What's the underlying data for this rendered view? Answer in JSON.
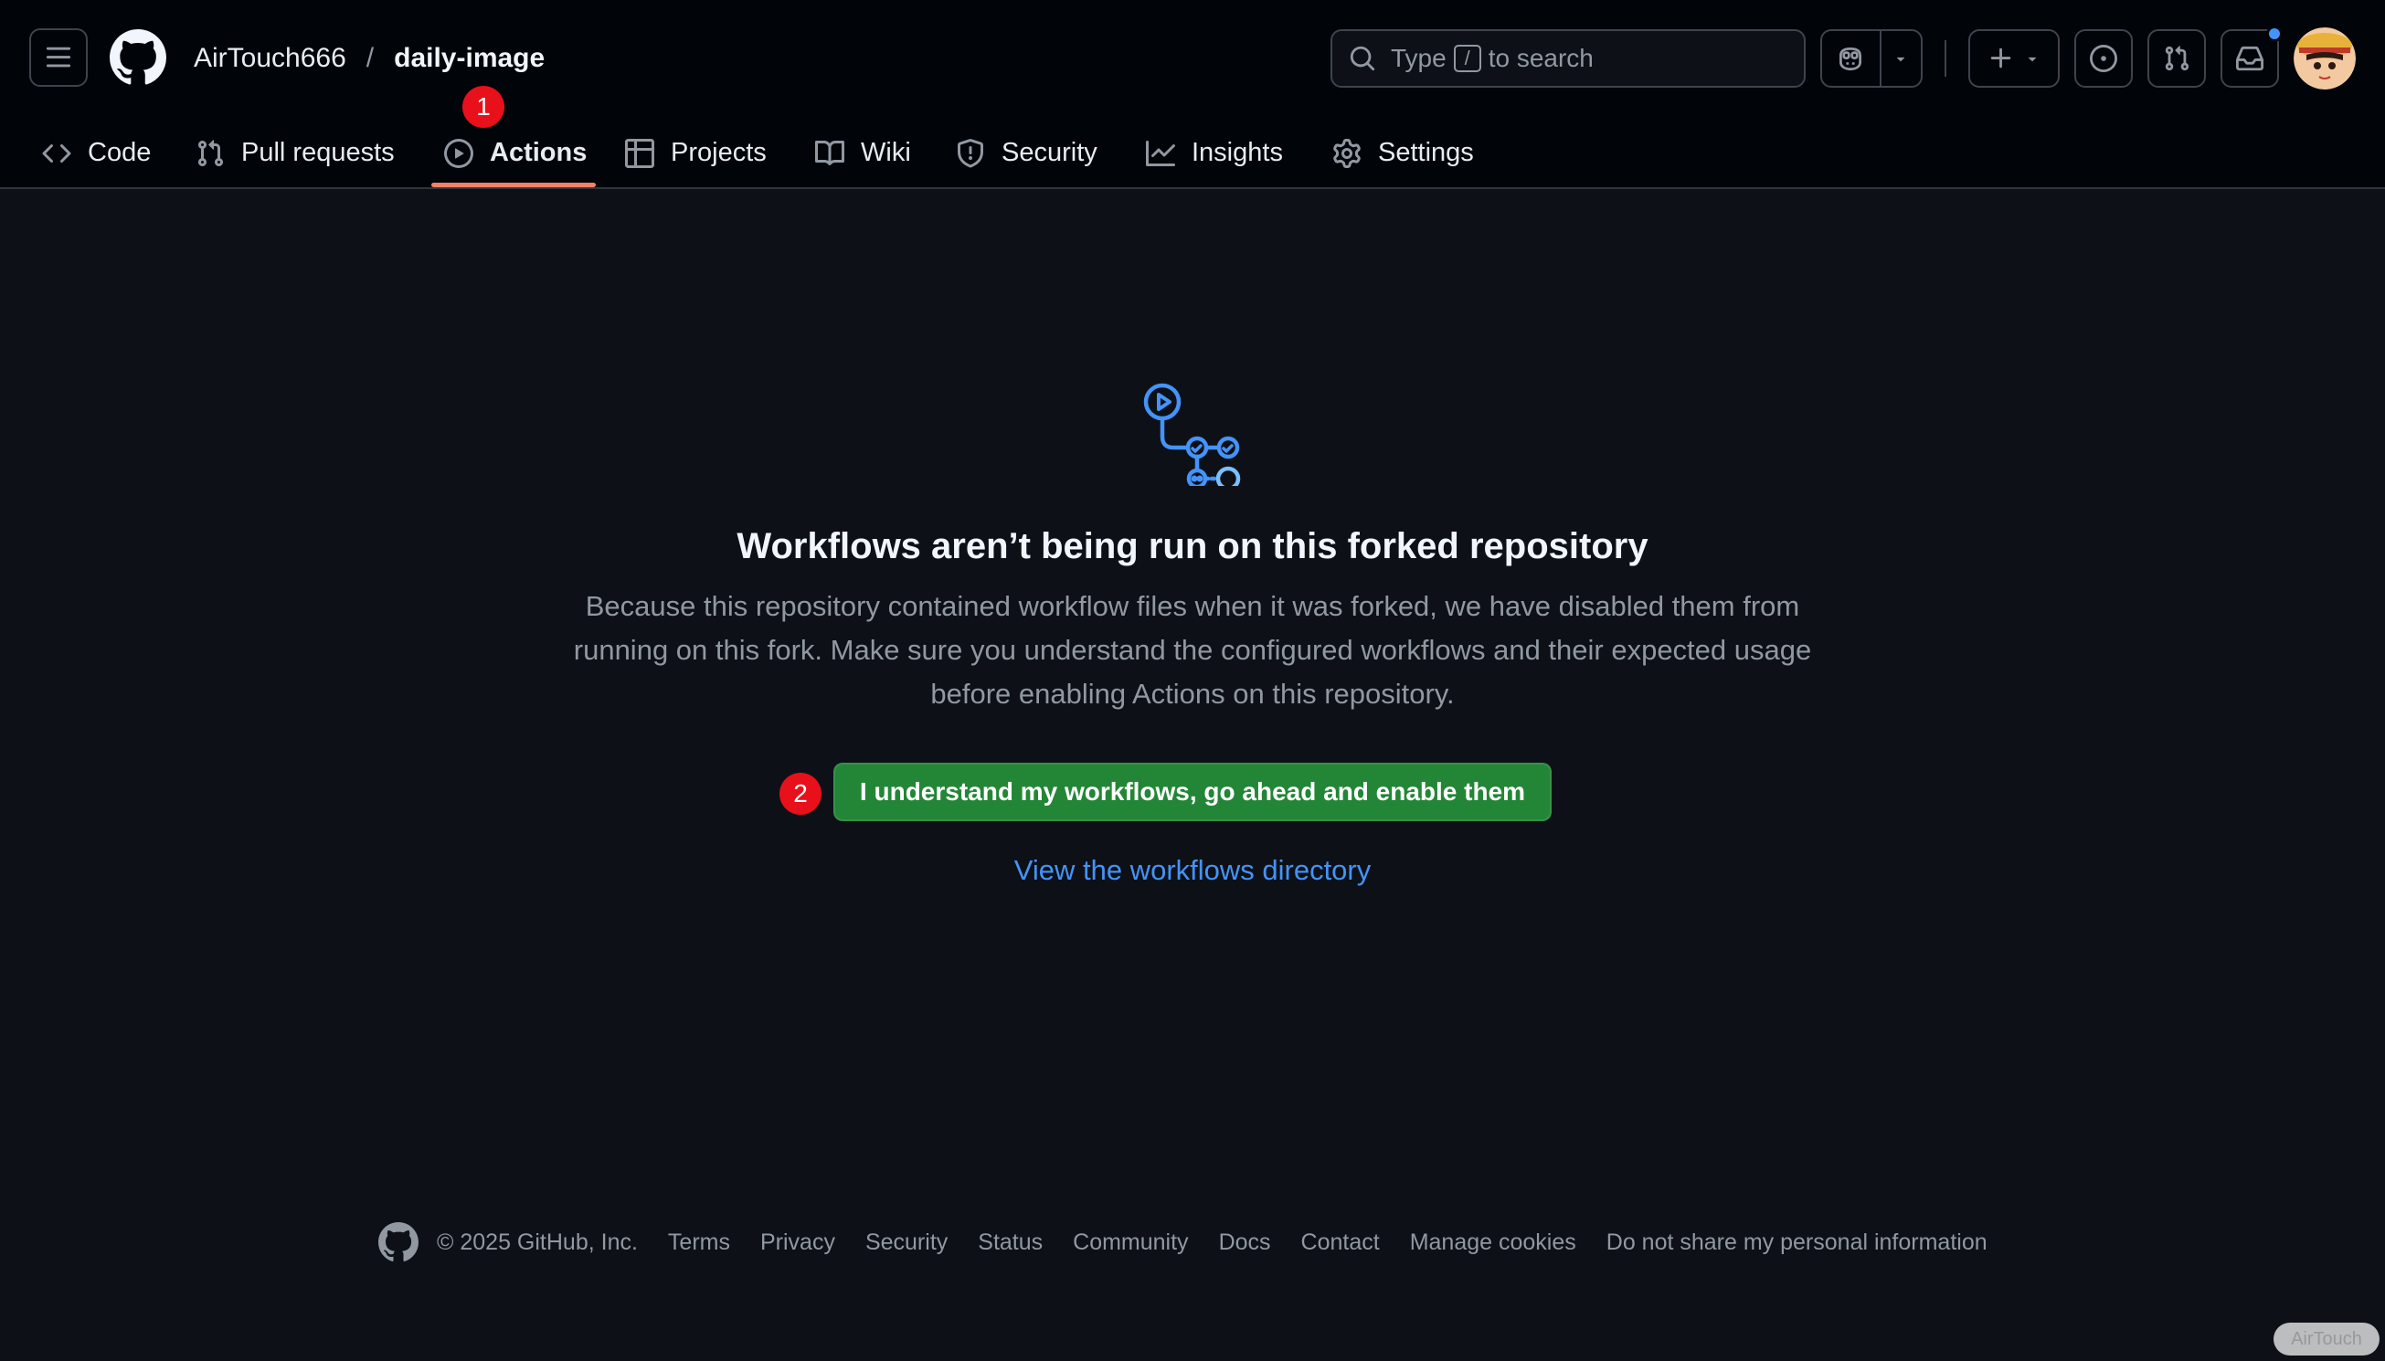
{
  "header": {
    "owner": "AirTouch666",
    "separator": "/",
    "repo": "daily-image",
    "search": {
      "before": "Type",
      "key": "/",
      "after": "to search"
    }
  },
  "tabs": [
    {
      "label": "Code",
      "icon": "code-icon"
    },
    {
      "label": "Pull requests",
      "icon": "git-pull-request-icon"
    },
    {
      "label": "Actions",
      "icon": "play-icon",
      "active": true
    },
    {
      "label": "Projects",
      "icon": "table-icon"
    },
    {
      "label": "Wiki",
      "icon": "book-icon"
    },
    {
      "label": "Security",
      "icon": "shield-icon"
    },
    {
      "label": "Insights",
      "icon": "graph-icon"
    },
    {
      "label": "Settings",
      "icon": "gear-icon"
    }
  ],
  "markers": {
    "one": "1",
    "two": "2"
  },
  "main": {
    "title": "Workflows aren’t being run on this forked repository",
    "description": "Because this repository contained workflow files when it was forked, we have disabled them from running on this fork. Make sure you understand the configured workflows and their expected usage before enabling Actions on this repository.",
    "enable_button": "I understand my workflows, go ahead and enable them",
    "view_link": "View the workflows directory"
  },
  "footer": {
    "copyright": "© 2025 GitHub, Inc.",
    "links": [
      "Terms",
      "Privacy",
      "Security",
      "Status",
      "Community",
      "Docs",
      "Contact",
      "Manage cookies",
      "Do not share my personal information"
    ]
  },
  "watermark": "AirTouch",
  "colors": {
    "background": "#0d1117",
    "header": "#010409",
    "accent_underline": "#f78166",
    "primary_button": "#238636",
    "link": "#4493f8",
    "marker": "#e8101a"
  }
}
